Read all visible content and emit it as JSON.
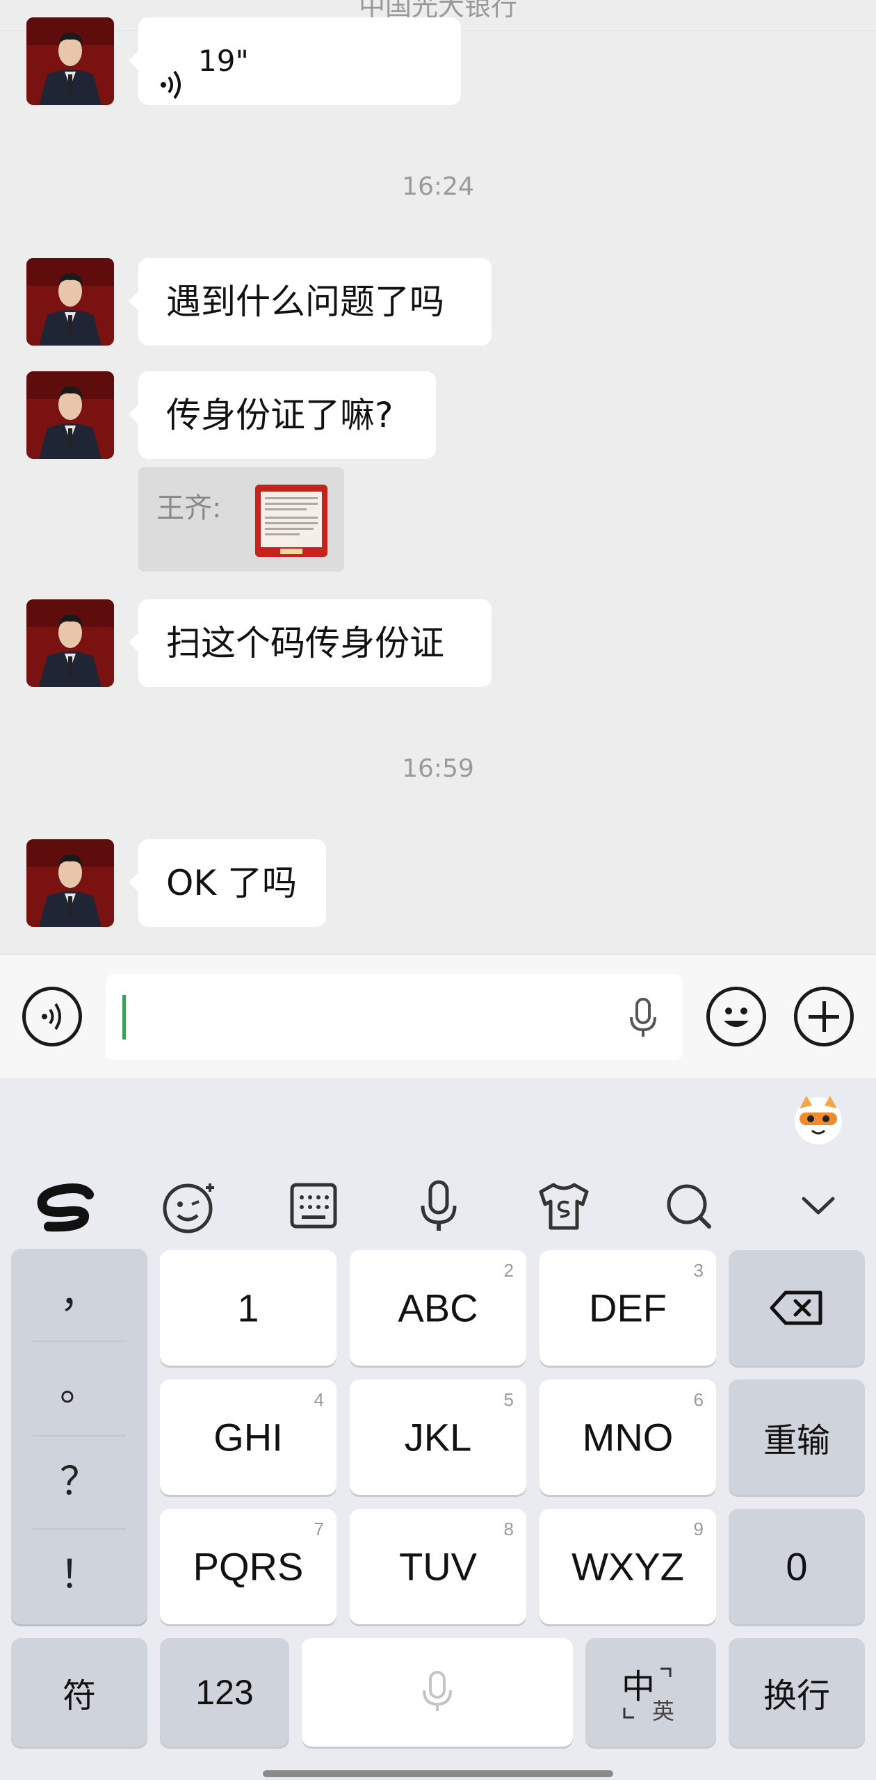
{
  "header": {
    "title": "中国光大银行"
  },
  "messages": [
    {
      "type": "voice",
      "duration": "19\""
    },
    {
      "type": "time",
      "text": "16:24"
    },
    {
      "type": "text",
      "text": "遇到什么问题了吗"
    },
    {
      "type": "text",
      "text": "传身份证了嘛?"
    },
    {
      "type": "quote",
      "sender": "王齐:"
    },
    {
      "type": "text",
      "text": "扫这个码传身份证"
    },
    {
      "type": "time",
      "text": "16:59"
    },
    {
      "type": "text",
      "text": "OK 了吗"
    }
  ],
  "input_bar": {
    "value": "",
    "icons": [
      "voice-mode-icon",
      "mic-icon",
      "emoji-icon",
      "plus-icon"
    ]
  },
  "keyboard": {
    "toolbar": [
      "sogou-logo-icon",
      "emoji-face-icon",
      "keyboard-icon",
      "voice-mic-icon",
      "skin-shirt-icon",
      "search-icon",
      "collapse-chevron-icon"
    ],
    "punctuation": [
      "，",
      "。",
      "？",
      "！"
    ],
    "keys": [
      {
        "label": "1",
        "sup": ""
      },
      {
        "label": "ABC",
        "sup": "2"
      },
      {
        "label": "DEF",
        "sup": "3"
      },
      {
        "label": "GHI",
        "sup": "4"
      },
      {
        "label": "JKL",
        "sup": "5"
      },
      {
        "label": "MNO",
        "sup": "6"
      },
      {
        "label": "PQRS",
        "sup": "7"
      },
      {
        "label": "TUV",
        "sup": "8"
      },
      {
        "label": "WXYZ",
        "sup": "9"
      }
    ],
    "right_keys": {
      "retype": "重输",
      "zero": "0"
    },
    "bottom": {
      "symbols": "符",
      "numbers": "123",
      "lang_main": "中",
      "lang_alt": "英",
      "enter": "换行"
    }
  }
}
